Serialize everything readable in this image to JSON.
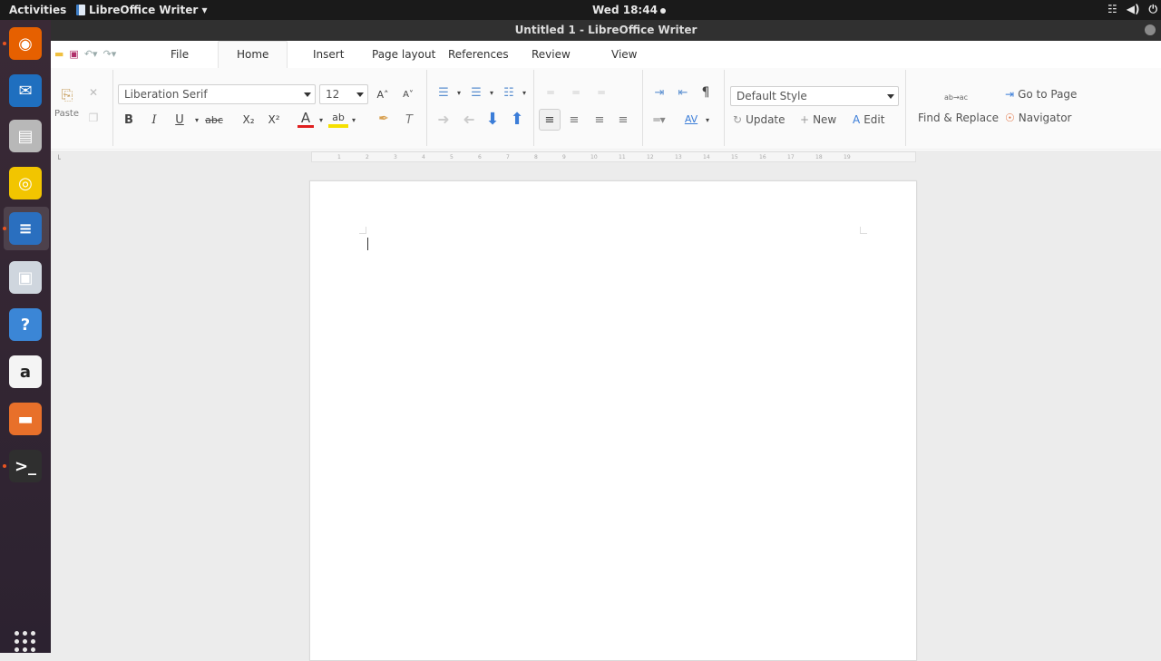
{
  "topbar": {
    "activities": "Activities",
    "app_menu": "LibreOffice Writer ▾",
    "clock": "Wed 18:44",
    "tray": [
      "network-icon",
      "volume-icon",
      "power-icon"
    ]
  },
  "window": {
    "title": "Untitled 1 - LibreOffice Writer"
  },
  "dock": {
    "items": [
      {
        "name": "firefox",
        "icon": "firefox-icon",
        "color": "#e66000",
        "glyph": "◉"
      },
      {
        "name": "thunderbird",
        "icon": "thunderbird-icon",
        "color": "#1f6fbf",
        "glyph": "✉"
      },
      {
        "name": "files-cabinet",
        "icon": "file-cabinet-icon",
        "color": "#b8b8b8",
        "glyph": "▤"
      },
      {
        "name": "rhythmbox",
        "icon": "rhythmbox-icon",
        "color": "#f2c500",
        "glyph": "◎"
      },
      {
        "name": "writer",
        "icon": "writer-icon",
        "color": "#2a6fbf",
        "glyph": "≡"
      },
      {
        "name": "software",
        "icon": "software-center-icon",
        "color": "#cfd6de",
        "glyph": "▣"
      },
      {
        "name": "help",
        "icon": "help-icon",
        "color": "#3b86d6",
        "glyph": "?"
      },
      {
        "name": "amazon",
        "icon": "amazon-icon",
        "color": "#f4f4f4",
        "glyph": "a"
      },
      {
        "name": "folder",
        "icon": "folder-icon",
        "color": "#e8702a",
        "glyph": "▬"
      },
      {
        "name": "terminal",
        "icon": "terminal-icon",
        "color": "#2f2f2f",
        "glyph": ">_"
      }
    ]
  },
  "tabs": [
    "File",
    "Home",
    "Insert",
    "Page layout",
    "References",
    "Review",
    "View"
  ],
  "ribbon": {
    "paste": "Paste",
    "font_name": "Liberation Serif",
    "font_size": "12",
    "style": "Default Style",
    "update": "Update",
    "new": "New",
    "edit": "Edit",
    "find_replace": "Find & Replace",
    "go_to_page": "Go to Page",
    "navigator": "Navigator",
    "bold": "B",
    "italic": "I",
    "underline": "U",
    "strike": "abc",
    "subscript": "X₂",
    "superscript": "X²",
    "font_color": "A",
    "highlight": "ab",
    "clear": "T",
    "grow": "A˄",
    "shrink": "A˅",
    "pilcrow": "¶",
    "spacing": "AV",
    "find_glyph": "ab→ac"
  },
  "ruler": {
    "marks": [
      "1",
      "2",
      "3",
      "4",
      "5",
      "6",
      "7",
      "8",
      "9",
      "10",
      "11",
      "12",
      "13",
      "14",
      "15",
      "16",
      "17",
      "18",
      "19"
    ]
  },
  "colors": {
    "accent": "#2a6fbf",
    "font_color": "#e02020",
    "highlight": "#f5e000",
    "arrow": "#3b7dd8"
  }
}
